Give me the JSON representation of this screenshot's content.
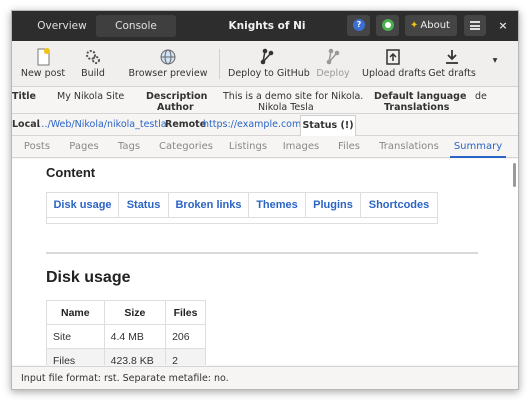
{
  "header": {
    "tabs": [
      "Overview",
      "Console"
    ],
    "title": "Knights of Ni",
    "help_icon": "help-icon",
    "github_icon": "github-icon",
    "about_label": "About",
    "close_glyph": "×"
  },
  "toolbar": {
    "new_post": "New post",
    "build": "Build",
    "browser_preview": "Browser preview",
    "deploy_github": "Deploy to GitHub",
    "deploy": "Deploy",
    "upload_drafts": "Upload drafts",
    "get_drafts": "Get drafts"
  },
  "meta": {
    "title_label": "Title",
    "title_value": "My Nikola Site",
    "description_label": "Description",
    "description_value": "This is a demo site for Nikola.",
    "author_label": "Author",
    "author_value": "Nikola Tesla",
    "language_label": "Default language",
    "language_value": "de",
    "translations_label": "Translations"
  },
  "location": {
    "local_label": "Local",
    "local_path": "…/Web/Nikola/nikola_testla",
    "remote_label": "Remote",
    "remote_url": "https://example.com/",
    "status_label": "Status (!)"
  },
  "tabs": [
    "Posts",
    "Pages",
    "Tags",
    "Categories",
    "Listings",
    "Images",
    "Files",
    "Translations",
    "Summary"
  ],
  "content": {
    "heading": "Content",
    "nav_links": [
      "Disk usage",
      "Status",
      "Broken links",
      "Themes",
      "Plugins",
      "Shortcodes"
    ],
    "disk_heading": "Disk usage",
    "disk_table": {
      "headers": [
        "Name",
        "Size",
        "Files"
      ],
      "rows": [
        [
          "Site",
          "4.4 MB",
          "206"
        ],
        [
          "Files",
          "423.8 KB",
          "2"
        ]
      ]
    }
  },
  "statusbar": {
    "text": "Input file format: rst. Separate metafile: no."
  }
}
